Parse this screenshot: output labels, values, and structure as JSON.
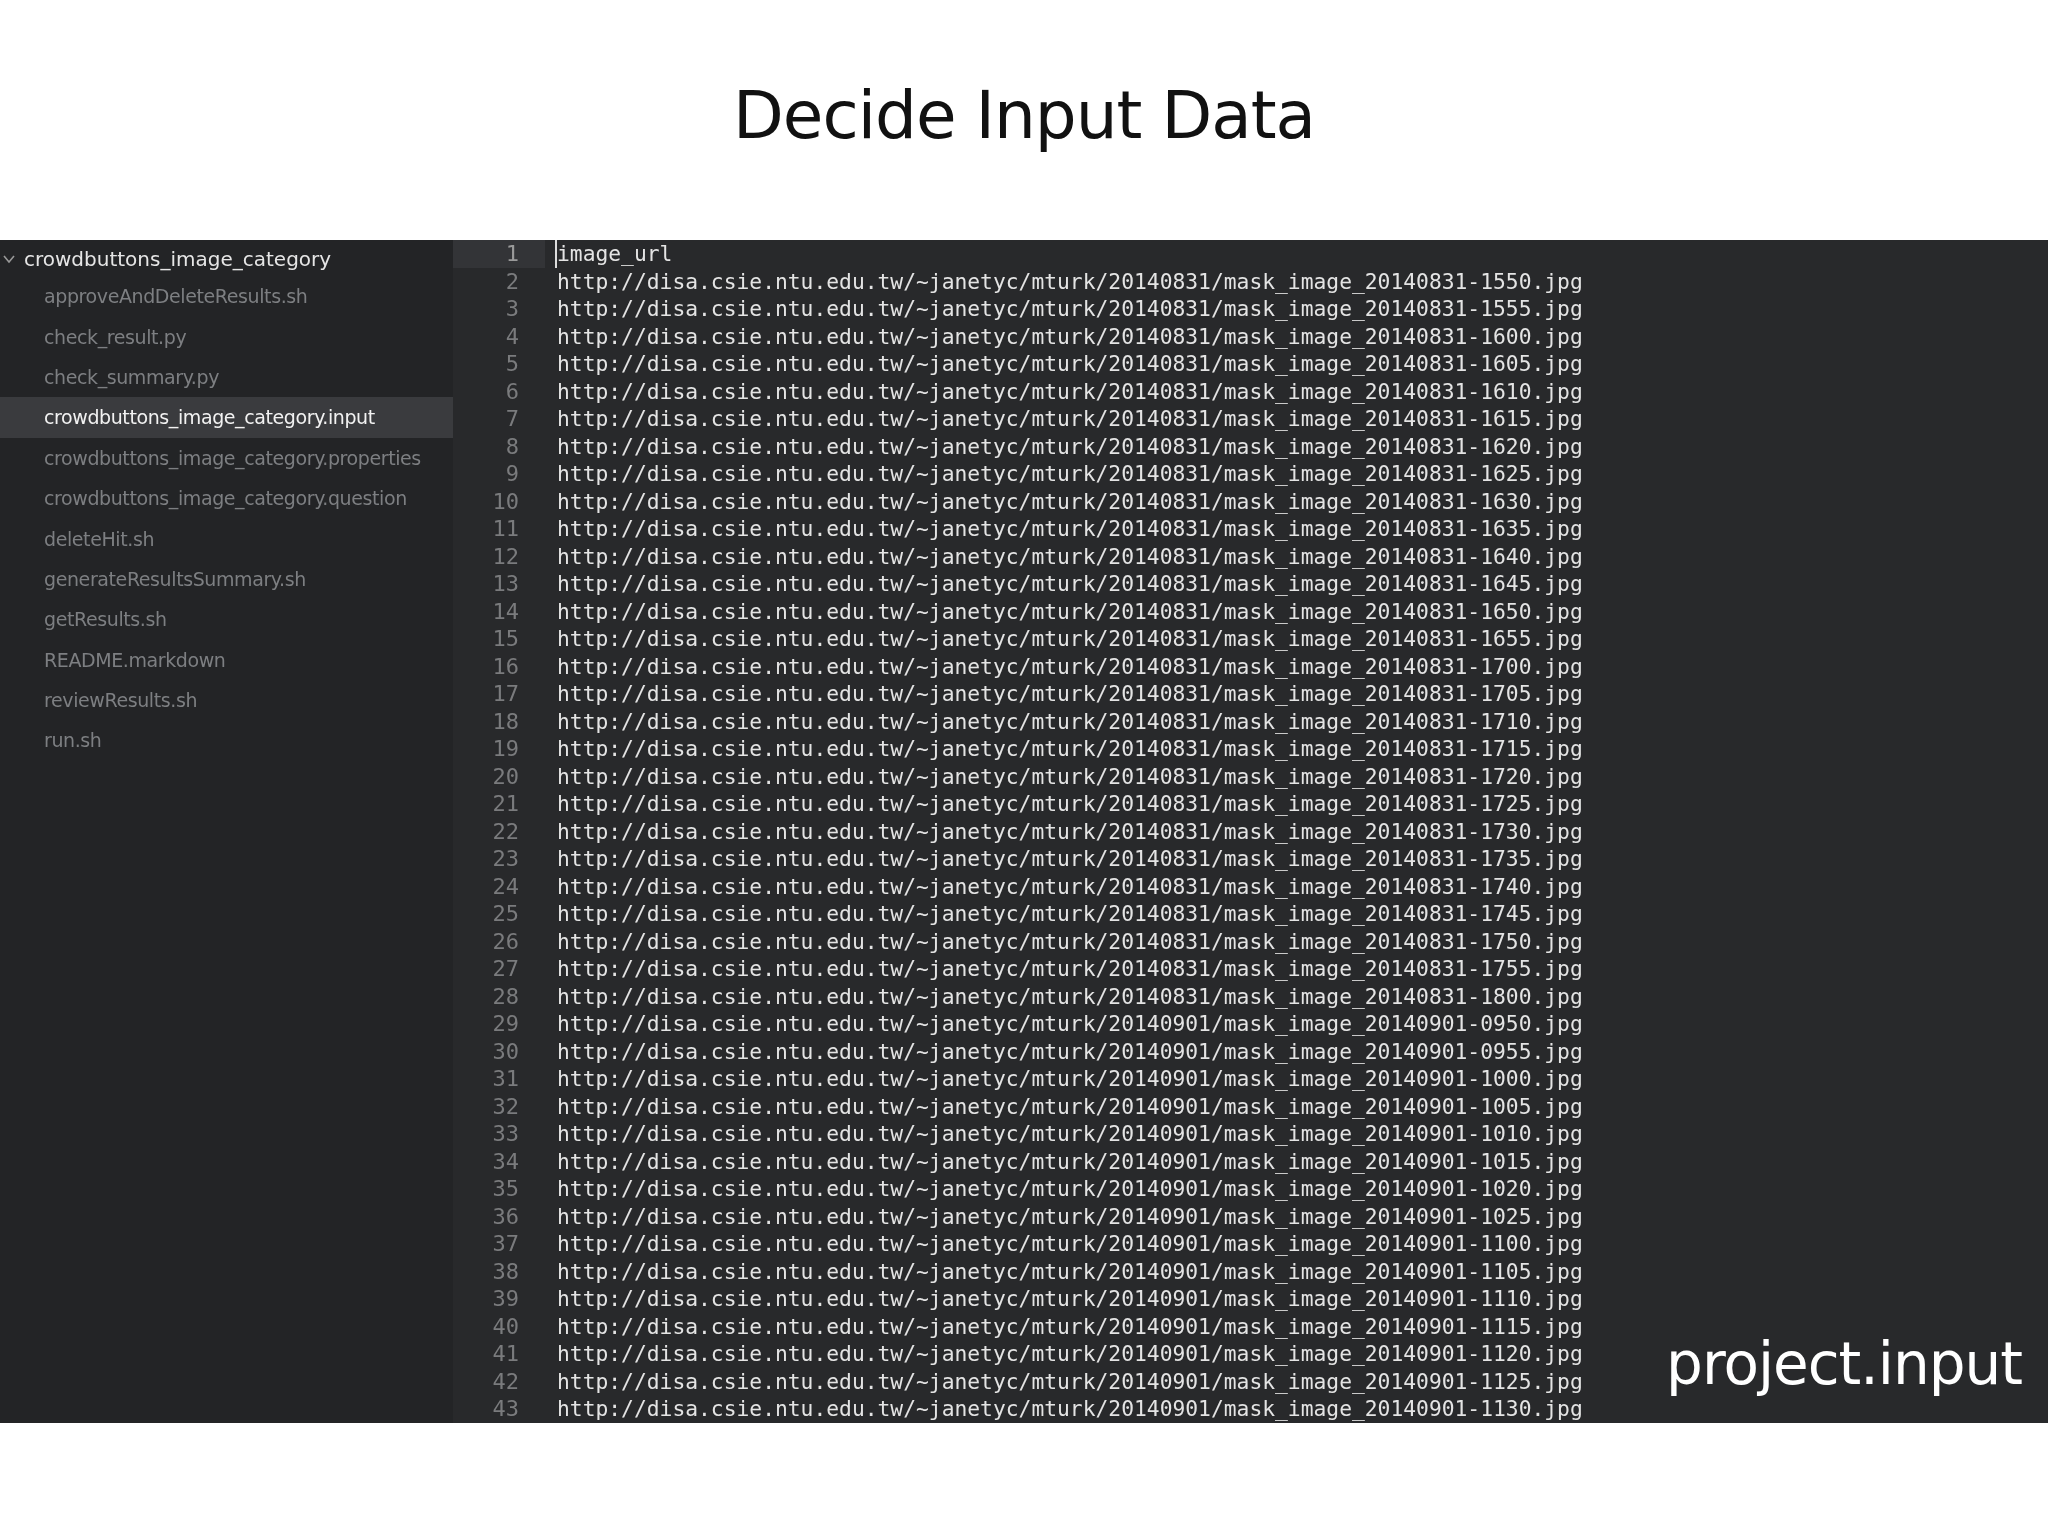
{
  "slide": {
    "title": "Decide Input Data",
    "caption": "project.input"
  },
  "sidebar": {
    "folder": {
      "label": "crowdbuttons_image_category",
      "expanded": true,
      "children": [
        {
          "label": "approveAndDeleteResults.sh",
          "selected": false
        },
        {
          "label": "check_result.py",
          "selected": false
        },
        {
          "label": "check_summary.py",
          "selected": false
        },
        {
          "label": "crowdbuttons_image_category.input",
          "selected": true
        },
        {
          "label": "crowdbuttons_image_category.properties",
          "selected": false
        },
        {
          "label": "crowdbuttons_image_category.question",
          "selected": false
        },
        {
          "label": "deleteHit.sh",
          "selected": false
        },
        {
          "label": "generateResultsSummary.sh",
          "selected": false
        },
        {
          "label": "getResults.sh",
          "selected": false
        },
        {
          "label": "README.markdown",
          "selected": false
        },
        {
          "label": "reviewResults.sh",
          "selected": false
        },
        {
          "label": "run.sh",
          "selected": false
        }
      ]
    }
  },
  "editor": {
    "lines": [
      {
        "number": "1",
        "text": "image_url",
        "current": true
      },
      {
        "number": "2",
        "text": "http://disa.csie.ntu.edu.tw/~janetyc/mturk/20140831/mask_image_20140831-1550.jpg",
        "current": false
      },
      {
        "number": "3",
        "text": "http://disa.csie.ntu.edu.tw/~janetyc/mturk/20140831/mask_image_20140831-1555.jpg",
        "current": false
      },
      {
        "number": "4",
        "text": "http://disa.csie.ntu.edu.tw/~janetyc/mturk/20140831/mask_image_20140831-1600.jpg",
        "current": false
      },
      {
        "number": "5",
        "text": "http://disa.csie.ntu.edu.tw/~janetyc/mturk/20140831/mask_image_20140831-1605.jpg",
        "current": false
      },
      {
        "number": "6",
        "text": "http://disa.csie.ntu.edu.tw/~janetyc/mturk/20140831/mask_image_20140831-1610.jpg",
        "current": false
      },
      {
        "number": "7",
        "text": "http://disa.csie.ntu.edu.tw/~janetyc/mturk/20140831/mask_image_20140831-1615.jpg",
        "current": false
      },
      {
        "number": "8",
        "text": "http://disa.csie.ntu.edu.tw/~janetyc/mturk/20140831/mask_image_20140831-1620.jpg",
        "current": false
      },
      {
        "number": "9",
        "text": "http://disa.csie.ntu.edu.tw/~janetyc/mturk/20140831/mask_image_20140831-1625.jpg",
        "current": false
      },
      {
        "number": "10",
        "text": "http://disa.csie.ntu.edu.tw/~janetyc/mturk/20140831/mask_image_20140831-1630.jpg",
        "current": false
      },
      {
        "number": "11",
        "text": "http://disa.csie.ntu.edu.tw/~janetyc/mturk/20140831/mask_image_20140831-1635.jpg",
        "current": false
      },
      {
        "number": "12",
        "text": "http://disa.csie.ntu.edu.tw/~janetyc/mturk/20140831/mask_image_20140831-1640.jpg",
        "current": false
      },
      {
        "number": "13",
        "text": "http://disa.csie.ntu.edu.tw/~janetyc/mturk/20140831/mask_image_20140831-1645.jpg",
        "current": false
      },
      {
        "number": "14",
        "text": "http://disa.csie.ntu.edu.tw/~janetyc/mturk/20140831/mask_image_20140831-1650.jpg",
        "current": false
      },
      {
        "number": "15",
        "text": "http://disa.csie.ntu.edu.tw/~janetyc/mturk/20140831/mask_image_20140831-1655.jpg",
        "current": false
      },
      {
        "number": "16",
        "text": "http://disa.csie.ntu.edu.tw/~janetyc/mturk/20140831/mask_image_20140831-1700.jpg",
        "current": false
      },
      {
        "number": "17",
        "text": "http://disa.csie.ntu.edu.tw/~janetyc/mturk/20140831/mask_image_20140831-1705.jpg",
        "current": false
      },
      {
        "number": "18",
        "text": "http://disa.csie.ntu.edu.tw/~janetyc/mturk/20140831/mask_image_20140831-1710.jpg",
        "current": false
      },
      {
        "number": "19",
        "text": "http://disa.csie.ntu.edu.tw/~janetyc/mturk/20140831/mask_image_20140831-1715.jpg",
        "current": false
      },
      {
        "number": "20",
        "text": "http://disa.csie.ntu.edu.tw/~janetyc/mturk/20140831/mask_image_20140831-1720.jpg",
        "current": false
      },
      {
        "number": "21",
        "text": "http://disa.csie.ntu.edu.tw/~janetyc/mturk/20140831/mask_image_20140831-1725.jpg",
        "current": false
      },
      {
        "number": "22",
        "text": "http://disa.csie.ntu.edu.tw/~janetyc/mturk/20140831/mask_image_20140831-1730.jpg",
        "current": false
      },
      {
        "number": "23",
        "text": "http://disa.csie.ntu.edu.tw/~janetyc/mturk/20140831/mask_image_20140831-1735.jpg",
        "current": false
      },
      {
        "number": "24",
        "text": "http://disa.csie.ntu.edu.tw/~janetyc/mturk/20140831/mask_image_20140831-1740.jpg",
        "current": false
      },
      {
        "number": "25",
        "text": "http://disa.csie.ntu.edu.tw/~janetyc/mturk/20140831/mask_image_20140831-1745.jpg",
        "current": false
      },
      {
        "number": "26",
        "text": "http://disa.csie.ntu.edu.tw/~janetyc/mturk/20140831/mask_image_20140831-1750.jpg",
        "current": false
      },
      {
        "number": "27",
        "text": "http://disa.csie.ntu.edu.tw/~janetyc/mturk/20140831/mask_image_20140831-1755.jpg",
        "current": false
      },
      {
        "number": "28",
        "text": "http://disa.csie.ntu.edu.tw/~janetyc/mturk/20140831/mask_image_20140831-1800.jpg",
        "current": false
      },
      {
        "number": "29",
        "text": "http://disa.csie.ntu.edu.tw/~janetyc/mturk/20140901/mask_image_20140901-0950.jpg",
        "current": false
      },
      {
        "number": "30",
        "text": "http://disa.csie.ntu.edu.tw/~janetyc/mturk/20140901/mask_image_20140901-0955.jpg",
        "current": false
      },
      {
        "number": "31",
        "text": "http://disa.csie.ntu.edu.tw/~janetyc/mturk/20140901/mask_image_20140901-1000.jpg",
        "current": false
      },
      {
        "number": "32",
        "text": "http://disa.csie.ntu.edu.tw/~janetyc/mturk/20140901/mask_image_20140901-1005.jpg",
        "current": false
      },
      {
        "number": "33",
        "text": "http://disa.csie.ntu.edu.tw/~janetyc/mturk/20140901/mask_image_20140901-1010.jpg",
        "current": false
      },
      {
        "number": "34",
        "text": "http://disa.csie.ntu.edu.tw/~janetyc/mturk/20140901/mask_image_20140901-1015.jpg",
        "current": false
      },
      {
        "number": "35",
        "text": "http://disa.csie.ntu.edu.tw/~janetyc/mturk/20140901/mask_image_20140901-1020.jpg",
        "current": false
      },
      {
        "number": "36",
        "text": "http://disa.csie.ntu.edu.tw/~janetyc/mturk/20140901/mask_image_20140901-1025.jpg",
        "current": false
      },
      {
        "number": "37",
        "text": "http://disa.csie.ntu.edu.tw/~janetyc/mturk/20140901/mask_image_20140901-1100.jpg",
        "current": false
      },
      {
        "number": "38",
        "text": "http://disa.csie.ntu.edu.tw/~janetyc/mturk/20140901/mask_image_20140901-1105.jpg",
        "current": false
      },
      {
        "number": "39",
        "text": "http://disa.csie.ntu.edu.tw/~janetyc/mturk/20140901/mask_image_20140901-1110.jpg",
        "current": false
      },
      {
        "number": "40",
        "text": "http://disa.csie.ntu.edu.tw/~janetyc/mturk/20140901/mask_image_20140901-1115.jpg",
        "current": false
      },
      {
        "number": "41",
        "text": "http://disa.csie.ntu.edu.tw/~janetyc/mturk/20140901/mask_image_20140901-1120.jpg",
        "current": false
      },
      {
        "number": "42",
        "text": "http://disa.csie.ntu.edu.tw/~janetyc/mturk/20140901/mask_image_20140901-1125.jpg",
        "current": false
      },
      {
        "number": "43",
        "text": "http://disa.csie.ntu.edu.tw/~janetyc/mturk/20140901/mask_image_20140901-1130.jpg",
        "current": false
      }
    ]
  }
}
